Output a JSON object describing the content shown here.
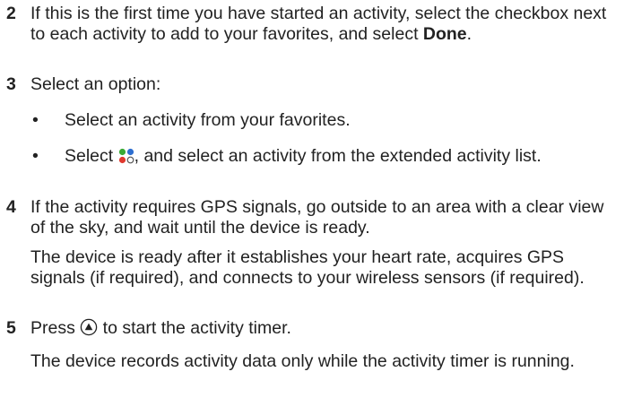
{
  "steps": [
    {
      "number": "2",
      "text_before": "If this is the first time you have started an activity, select the checkbox next to each activity to add to your favorites, and select ",
      "bold": "Done",
      "text_after": "."
    },
    {
      "number": "3",
      "text": "Select an option:",
      "bullets": [
        {
          "text": "Select an activity from your favorites."
        },
        {
          "text_before": "Select ",
          "icon": "activities-grid-icon",
          "text_after": ", and select an activity from the extended activity list."
        }
      ]
    },
    {
      "number": "4",
      "text": "If the activity requires GPS signals, go outside to an area with a clear view of the sky, and wait until the device is ready.",
      "note": "The device is ready after it establishes your heart rate, acquires GPS signals (if required), and connects to your wireless sensors (if required)."
    },
    {
      "number": "5",
      "text_before": "Press ",
      "icon": "start-button-icon",
      "text_after": " to start the activity timer.",
      "note": "The device records activity data only while the activity timer is running."
    }
  ],
  "bullet_char": "•",
  "colors": {
    "text": "#222222",
    "icon_green": "#3aaa35",
    "icon_blue": "#2e6fd0",
    "icon_red": "#e03a2f",
    "icon_outline": "#555555"
  }
}
